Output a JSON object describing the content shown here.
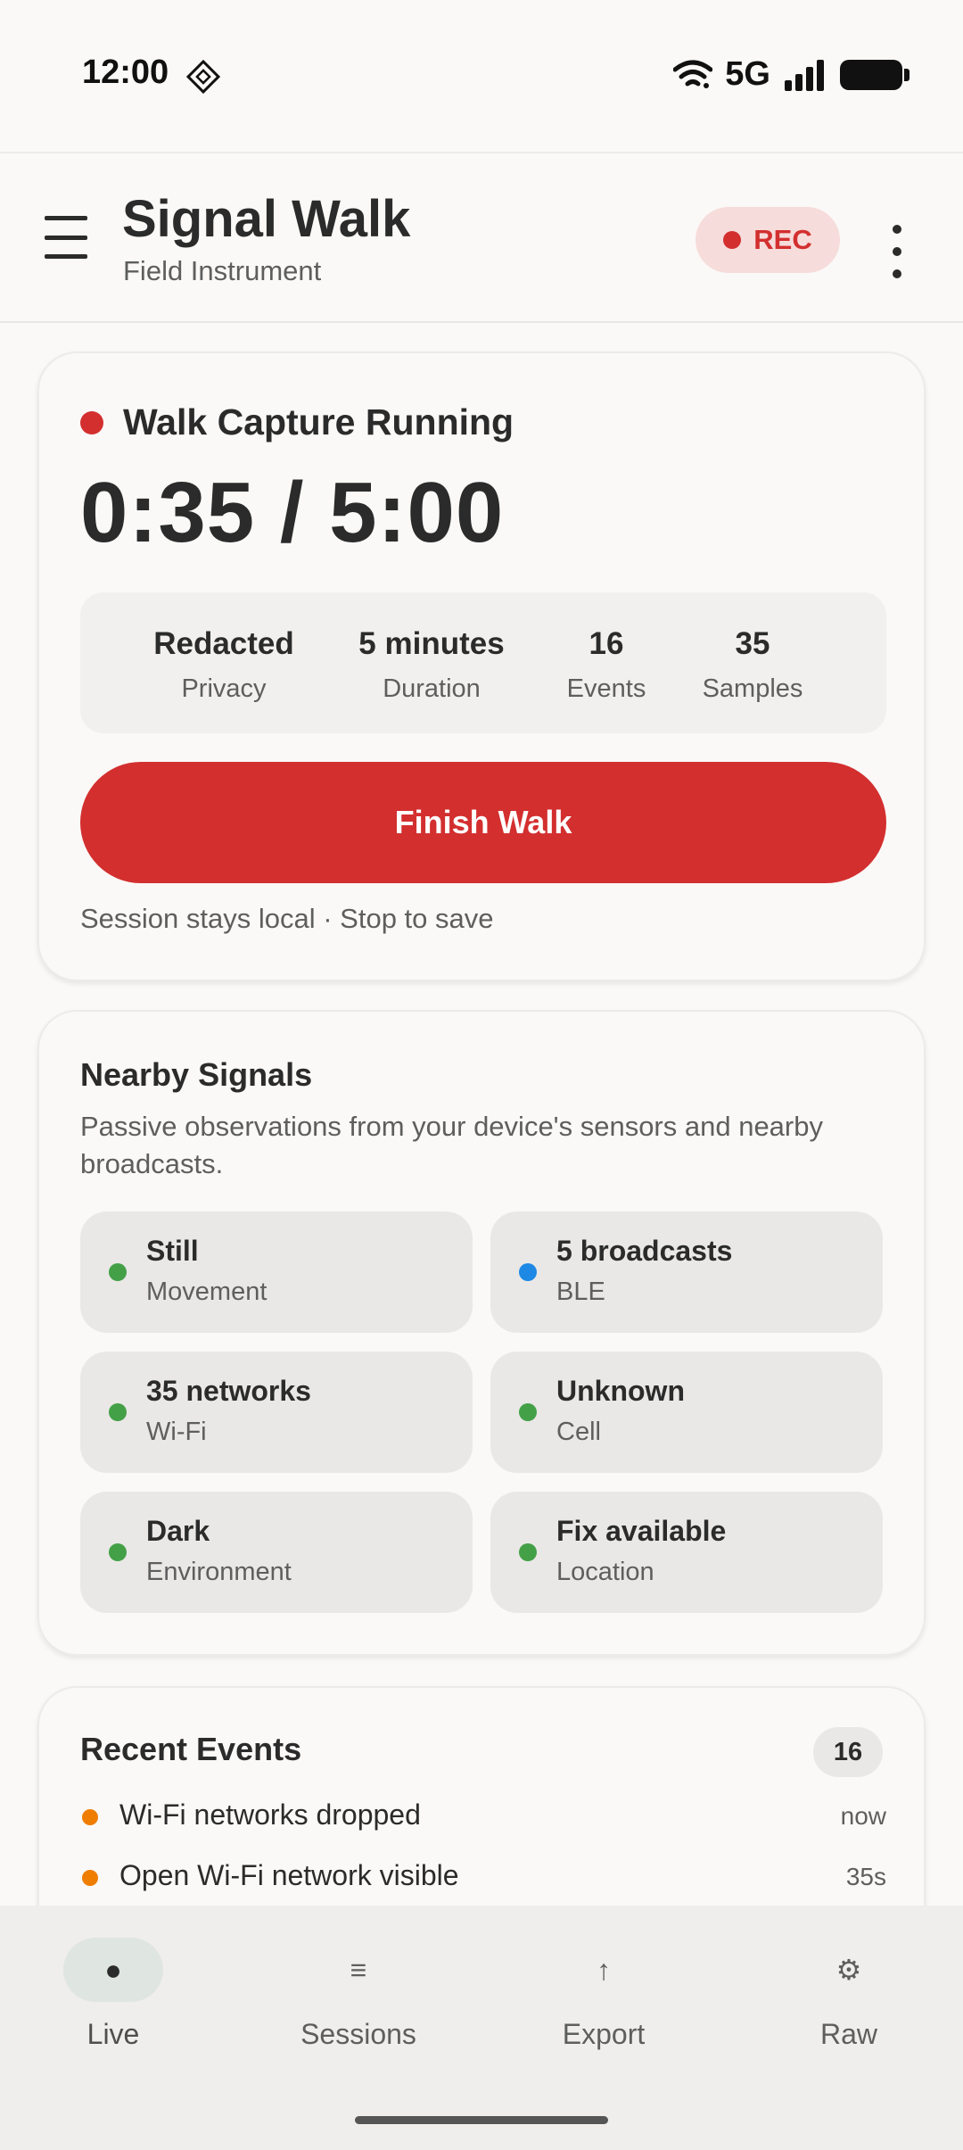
{
  "status_bar": {
    "time": "12:00",
    "network": "5G",
    "icons": [
      "notification-icon",
      "wifi-icon",
      "signal-bars-icon",
      "battery-icon"
    ]
  },
  "app_bar": {
    "title": "Signal Walk",
    "subtitle": "Field Instrument",
    "rec_label": "REC",
    "icons": [
      "menu-icon",
      "more-vert-icon"
    ]
  },
  "capture": {
    "title": "Walk Capture Running",
    "timer": "0:35 / 5:00",
    "stats": [
      {
        "value": "Redacted",
        "label": "Privacy"
      },
      {
        "value": "5 minutes",
        "label": "Duration"
      },
      {
        "value": "16",
        "label": "Events"
      },
      {
        "value": "35",
        "label": "Samples"
      }
    ],
    "finish_label": "Finish Walk",
    "note": "Session stays local · Stop to save"
  },
  "signals": {
    "title": "Nearby Signals",
    "description": "Passive observations from your device's sensors and nearby broadcasts.",
    "tiles": [
      {
        "value": "Still",
        "label": "Movement",
        "color": "#43a047"
      },
      {
        "value": "5 broadcasts",
        "label": "BLE",
        "color": "#1e88e5"
      },
      {
        "value": "35 networks",
        "label": "Wi-Fi",
        "color": "#43a047"
      },
      {
        "value": "Unknown",
        "label": "Cell",
        "color": "#43a047"
      },
      {
        "value": "Dark",
        "label": "Environment",
        "color": "#43a047"
      },
      {
        "value": "Fix available",
        "label": "Location",
        "color": "#43a047"
      }
    ]
  },
  "events": {
    "title": "Recent Events",
    "count": "16",
    "items": [
      {
        "text": "Wi-Fi networks dropped",
        "time": "now",
        "color": "#ef7d00"
      },
      {
        "text": "Open Wi-Fi network visible",
        "time": "35s",
        "color": "#ef7d00"
      }
    ]
  },
  "bottom_nav": {
    "items": [
      {
        "label": "Live",
        "icon": "●",
        "icon_name": "live-dot-icon",
        "active": true
      },
      {
        "label": "Sessions",
        "icon": "≡",
        "icon_name": "list-icon",
        "active": false
      },
      {
        "label": "Export",
        "icon": "↑",
        "icon_name": "upload-arrow-icon",
        "active": false
      },
      {
        "label": "Raw",
        "icon": "⚙",
        "icon_name": "gear-icon",
        "active": false
      }
    ]
  },
  "colors": {
    "accent_red": "#d32f2f",
    "rec_badge_bg": "#f6dcdb",
    "event_orange": "#ef7d00",
    "ok_green": "#43a047",
    "info_blue": "#1e88e5"
  }
}
